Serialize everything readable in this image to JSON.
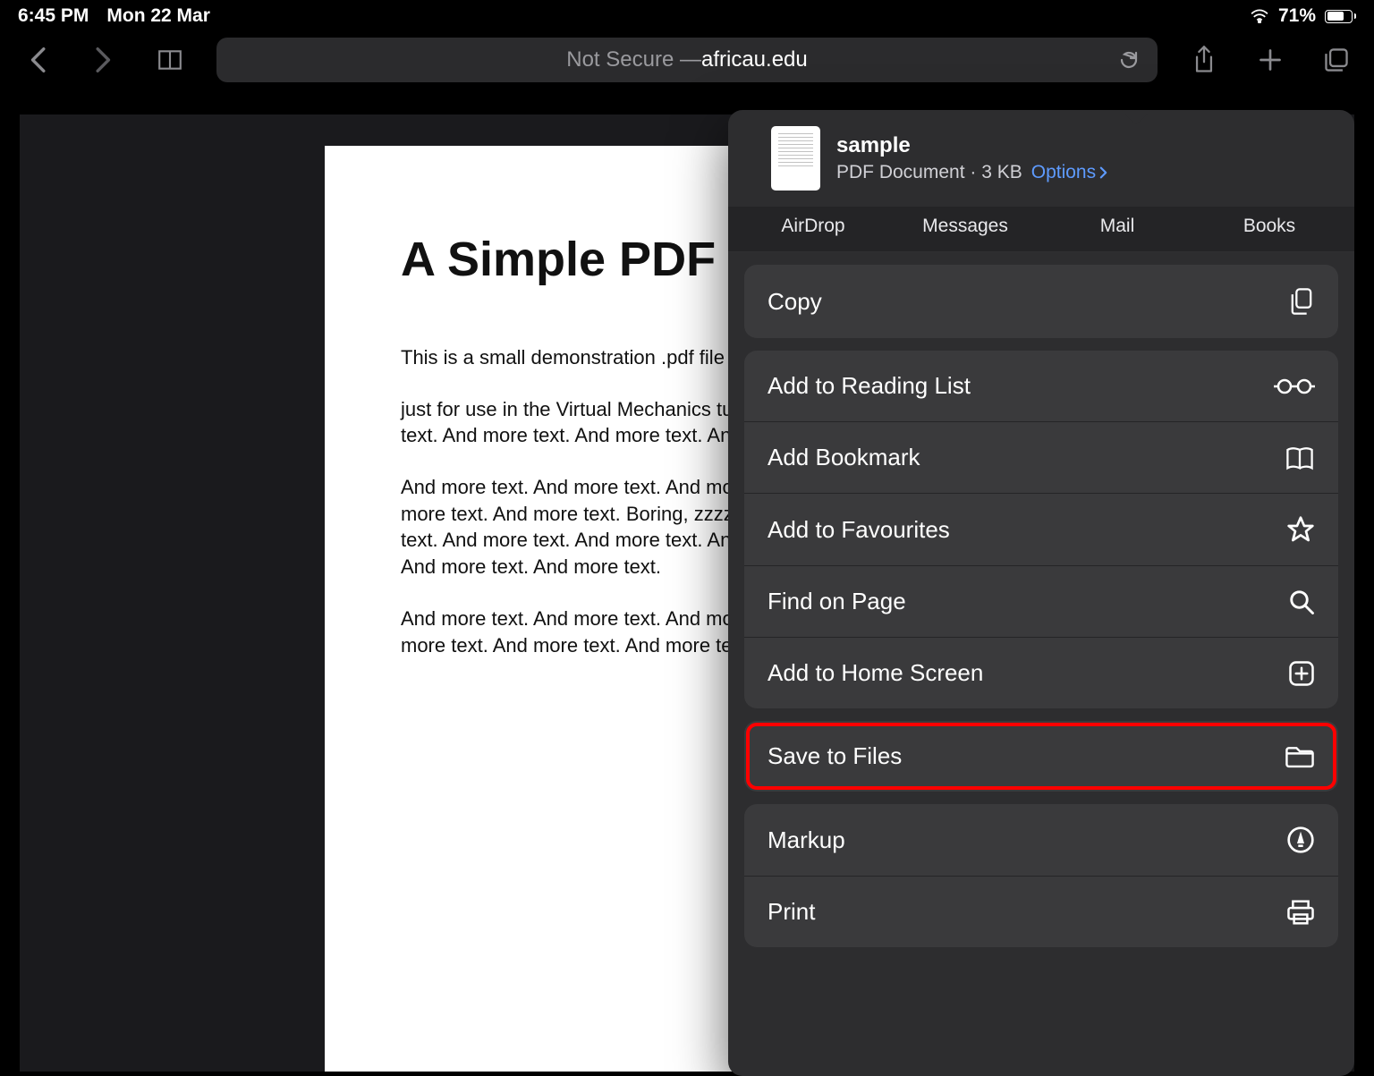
{
  "status": {
    "time": "6:45 PM",
    "date": "Mon 22 Mar",
    "battery_pct": "71%"
  },
  "address_bar": {
    "prefix": "Not Secure — ",
    "host": "africau.edu"
  },
  "pdf": {
    "title": "A Simple PDF File",
    "p1": "This is a small demonstration .pdf file -",
    "p2": "just for use in the Virtual Mechanics tutorials. More text. And more text. And more text. And more text. And more text.",
    "p3": "And more text. And more text. And more text. And more text. And more text. And more text. Boring, zzzzz. And more text. And more text. And more text. And more text. And more text. And more text. And more text. And more text.",
    "p4": "And more text. And more text. And more text. And more text. And more text. And more text. And more text. Even more. Continu"
  },
  "share_sheet": {
    "file_name": "sample",
    "file_sub": "PDF Document · 3 KB",
    "options": "Options",
    "targets": [
      "AirDrop",
      "Messages",
      "Mail",
      "Books"
    ],
    "actions": {
      "copy": "Copy",
      "reading_list": "Add to Reading List",
      "bookmark": "Add Bookmark",
      "favourites": "Add to Favourites",
      "find": "Find on Page",
      "home_screen": "Add to Home Screen",
      "save_files": "Save to Files",
      "markup": "Markup",
      "print": "Print"
    }
  }
}
